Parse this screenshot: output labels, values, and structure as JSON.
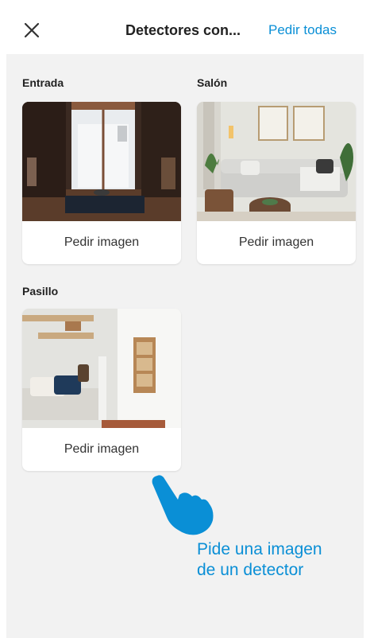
{
  "header": {
    "close_icon": "close-icon",
    "title": "Detectores con...",
    "request_all_label": "Pedir todas"
  },
  "rooms": [
    {
      "name": "Entrada",
      "action_label": "Pedir imagen"
    },
    {
      "name": "Salón",
      "action_label": "Pedir imagen"
    },
    {
      "name": "Pasillo",
      "action_label": "Pedir imagen"
    }
  ],
  "hint": {
    "icon": "pointing-hand-icon",
    "line1": "Pide una imagen",
    "line2": "de un detector"
  },
  "colors": {
    "accent": "#0a8fd6",
    "background": "#f2f2f2",
    "card": "#ffffff"
  }
}
